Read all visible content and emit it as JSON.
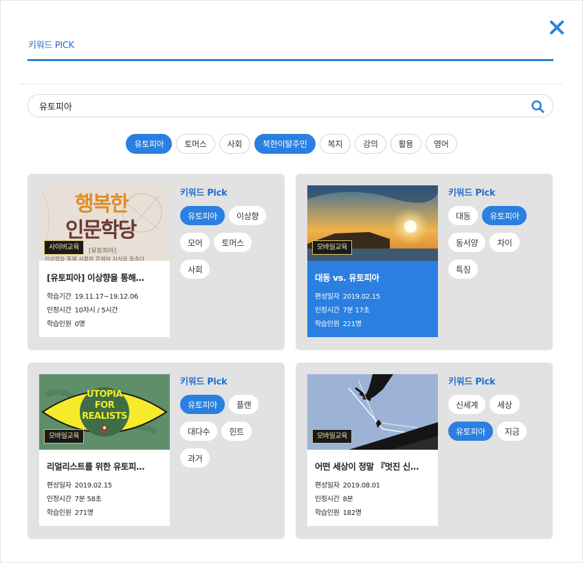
{
  "header": {
    "title": "키워드 PICK"
  },
  "search": {
    "value": "유토피아",
    "icon": "search-icon"
  },
  "close": {
    "icon": "close-icon",
    "color": "#2a7fe0"
  },
  "colors": {
    "accent": "#2a7fe0",
    "card_bg": "#e2e2e2"
  },
  "keywords": [
    {
      "label": "유토피아",
      "active": true
    },
    {
      "label": "토머스",
      "active": false
    },
    {
      "label": "사회",
      "active": false
    },
    {
      "label": "북한이탈주민",
      "active": true
    },
    {
      "label": "복지",
      "active": false
    },
    {
      "label": "강의",
      "active": false
    },
    {
      "label": "활용",
      "active": false
    },
    {
      "label": "영어",
      "active": false
    }
  ],
  "cards": [
    {
      "badge": "사이버교육",
      "title": "[유토피아] 이상향을 통해…",
      "highlighted": false,
      "thumb_text": {
        "line1": "행복한",
        "line2": "인문학당",
        "tag": "[유토피아]",
        "sub": "이상향을 통해 사회의 문제와 지식을 돌추다"
      },
      "rows": [
        {
          "label": "학습기간",
          "value": "19.11.17~19.12.06"
        },
        {
          "label": "인정시간",
          "value": "10차시 / 5시간"
        },
        {
          "label": "학습인원",
          "value": "0명"
        }
      ],
      "kw_title": "키워드 Pick",
      "kw": [
        {
          "label": "유토피아",
          "active": true
        },
        {
          "label": "이상향",
          "active": false
        },
        {
          "label": "모어",
          "active": false
        },
        {
          "label": "토머스",
          "active": false
        },
        {
          "label": "사회",
          "active": false
        }
      ]
    },
    {
      "badge": "모바일교육",
      "title": "대동 vs. 유토피아",
      "highlighted": true,
      "rows": [
        {
          "label": "편성일자",
          "value": "2019.02.15"
        },
        {
          "label": "인정시간",
          "value": "7분 17초"
        },
        {
          "label": "학습인원",
          "value": "221명"
        }
      ],
      "kw_title": "키워드 Pick",
      "kw": [
        {
          "label": "대동",
          "active": false
        },
        {
          "label": "유토피아",
          "active": true
        },
        {
          "label": "동서양",
          "active": false
        },
        {
          "label": "차이",
          "active": false
        },
        {
          "label": "특징",
          "active": false
        }
      ]
    },
    {
      "badge": "모바일교육",
      "title": "리얼리스트를 위한 유토피…",
      "highlighted": false,
      "thumb_text": {
        "line1": "UTOPIA",
        "line2": "FOR",
        "line3": "REALISTS"
      },
      "rows": [
        {
          "label": "편성일자",
          "value": "2019.02.15"
        },
        {
          "label": "인정시간",
          "value": "7분 58초"
        },
        {
          "label": "학습인원",
          "value": "271명"
        }
      ],
      "kw_title": "키워드 Pick",
      "kw": [
        {
          "label": "유토피아",
          "active": true
        },
        {
          "label": "플랜",
          "active": false
        },
        {
          "label": "대다수",
          "active": false
        },
        {
          "label": "힌트",
          "active": false
        },
        {
          "label": "과거",
          "active": false
        }
      ]
    },
    {
      "badge": "모바일교육",
      "title": "어떤 세상이 정말 『멋진 신…",
      "highlighted": false,
      "rows": [
        {
          "label": "편성일자",
          "value": "2019.08.01"
        },
        {
          "label": "인정시간",
          "value": "8분"
        },
        {
          "label": "학습인원",
          "value": "182명"
        }
      ],
      "kw_title": "키워드 Pick",
      "kw": [
        {
          "label": "신세계",
          "active": false
        },
        {
          "label": "세상",
          "active": false
        },
        {
          "label": "유토피아",
          "active": true
        },
        {
          "label": "지금",
          "active": false
        }
      ]
    }
  ]
}
